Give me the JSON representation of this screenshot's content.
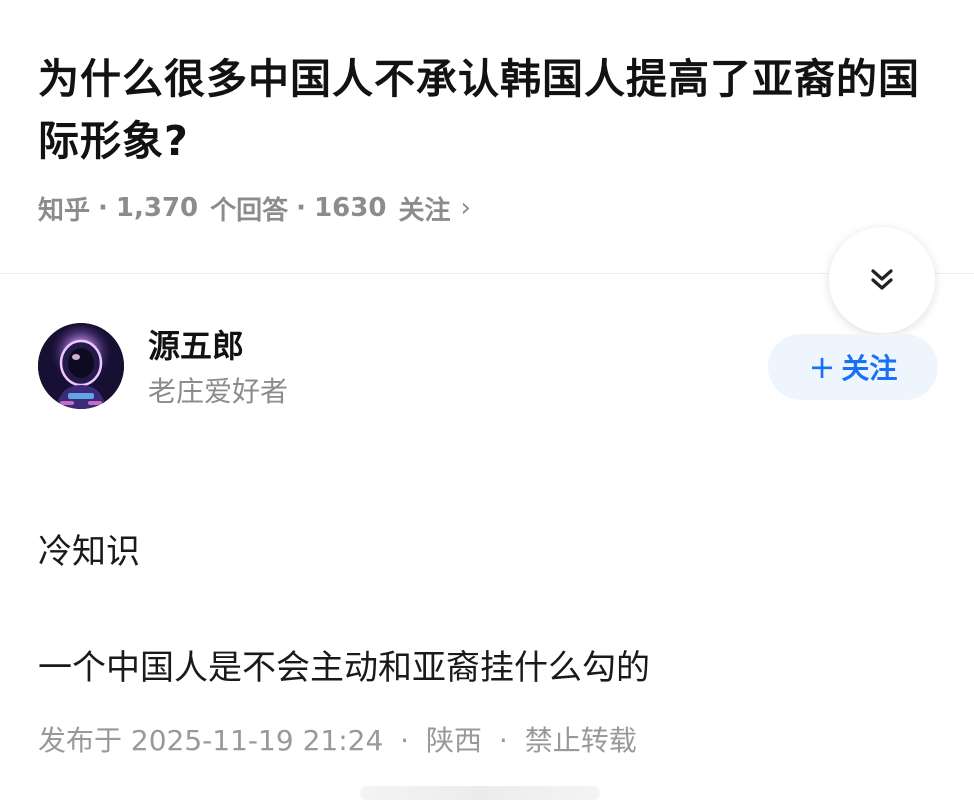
{
  "question": {
    "title": "为什么很多中国人不承认韩国人提高了亚裔的国际形象?",
    "source": "知乎",
    "answer_count": "1,370",
    "answer_label": "个回答",
    "follower_count": "1630",
    "follower_label": "关注",
    "chevron": "›"
  },
  "author": {
    "name": "源五郎",
    "bio": "老庄爱好者",
    "follow_plus": "+",
    "follow_label": "关注"
  },
  "answer": {
    "paragraphs": [
      "冷知识",
      "一个中国人是不会主动和亚裔挂什么勾的"
    ],
    "publish_prefix": "发布于",
    "publish_date": "2025-11-19",
    "publish_time": "21:24",
    "location": "陕西",
    "copyright": "禁止转载"
  },
  "icons": {
    "collapse": "double-chevron-down-icon",
    "avatar": "astronaut-avatar"
  },
  "colors": {
    "accent": "#1772f6",
    "follow_bg": "#eef5fd",
    "meta_gray": "#8c8c8c"
  }
}
